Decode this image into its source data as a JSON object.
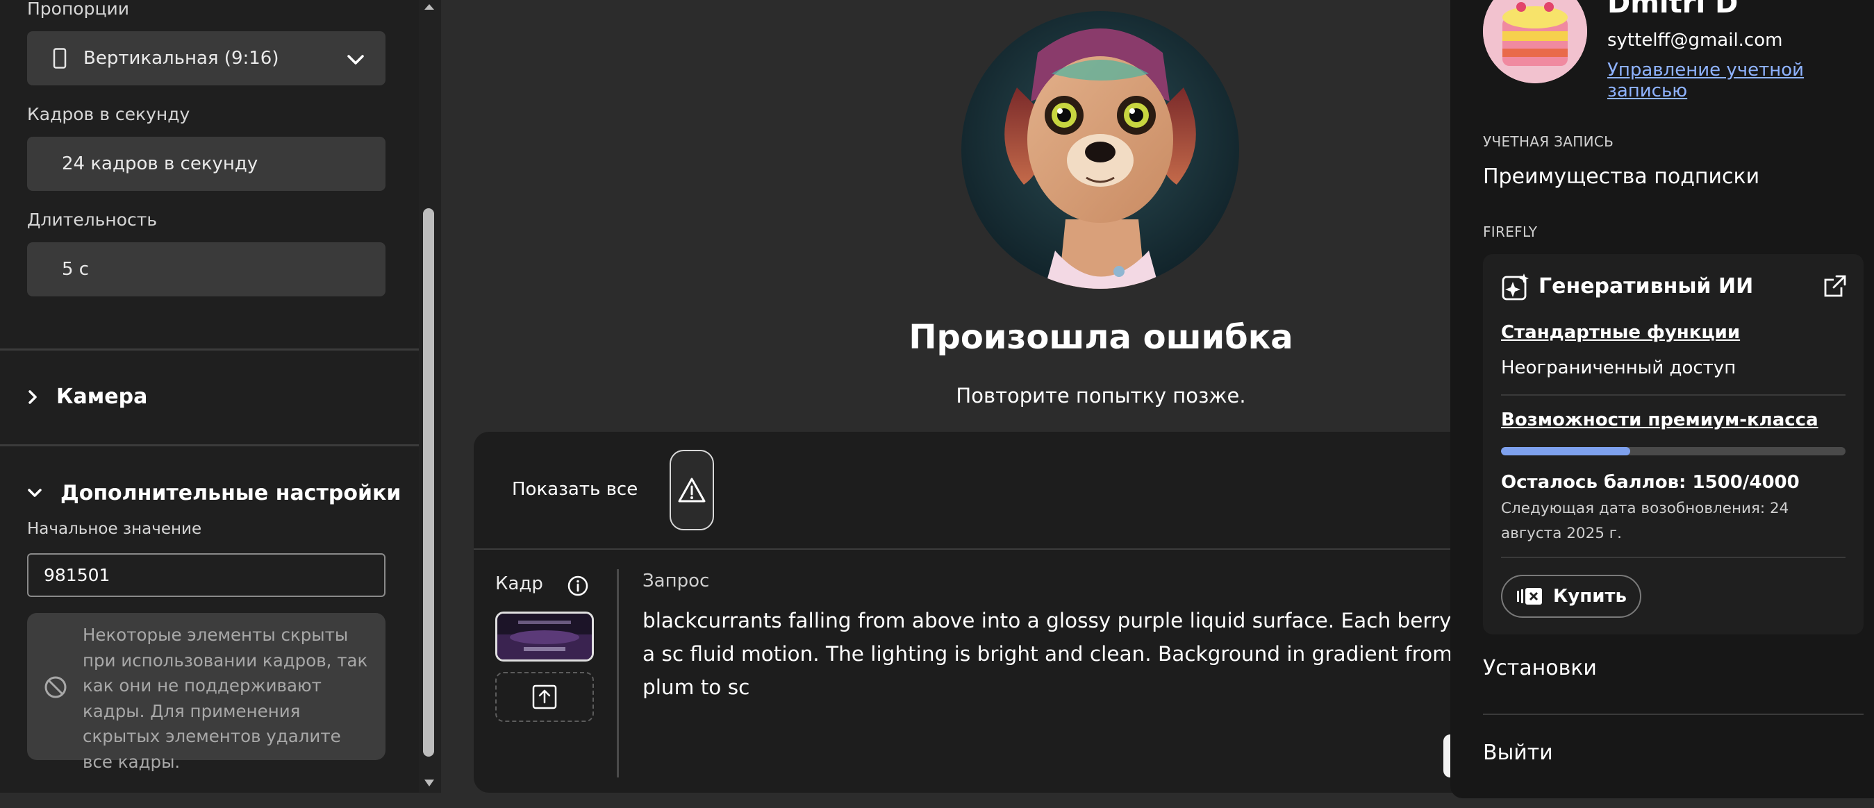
{
  "left_panel": {
    "aspect_label": "Пропорции",
    "aspect_value": "Вертикальная (9:16)",
    "fps_label": "Кадров в секунду",
    "fps_value": "24 кадров в секунду",
    "duration_label": "Длительность",
    "duration_value": "5 с",
    "camera_section": "Камера",
    "advanced_section": "Дополнительные настройки",
    "seed_label": "Начальное значение",
    "seed_value": "981501",
    "notice": "Некоторые элементы скрыты при использовании кадров, так как они не поддерживают кадры. Для применения скрытых элементов удалите все кадры."
  },
  "center": {
    "error_title": "Произошла ошибка",
    "error_subtitle": "Повторите попытку позже."
  },
  "prompt_card": {
    "show_all": "Показать все",
    "frame_label": "Кадр",
    "prompt_label": "Запрос",
    "prompt_text": "blackcurrants falling from above into a glossy purple liquid surface. Each berry creates a sc fluid motion. The lighting is bright and clean. Background in gradient from deep plum to sc"
  },
  "account": {
    "name": "Dmitri D",
    "email": "syttelff@gmail.com",
    "manage_link": "Управление учетной записью",
    "account_caption": "УЧЕТНАЯ ЗАПИСЬ",
    "benefits": "Преимущества подписки",
    "firefly_caption": "FIREFLY",
    "gen_ai_title": "Генеративный ИИ",
    "standard_features": "Стандартные функции",
    "unlimited": "Неограниченный доступ",
    "premium_features": "Возможности премиум-класса",
    "credits_used_fraction": 0.375,
    "points_left": "Осталось баллов: 1500/4000",
    "renewal": "Следующая дата возобновления: 24 августа 2025 г.",
    "buy": "Купить",
    "settings": "Установки",
    "logout": "Выйти"
  },
  "colors": {
    "accent_link": "#8fb3ff",
    "progress_fill": "#7ea1ee",
    "panel_bg": "#1f1f1f",
    "flyout_bg": "#171717"
  },
  "icons": [
    "portrait-aspect-icon",
    "chevron-down-icon",
    "chevron-right-icon",
    "warning-icon",
    "info-icon",
    "upload-icon",
    "no-entry-icon",
    "sparkle-icon",
    "external-link-icon",
    "credits-icon",
    "scroll-up-arrow-icon",
    "scroll-down-arrow-icon"
  ]
}
